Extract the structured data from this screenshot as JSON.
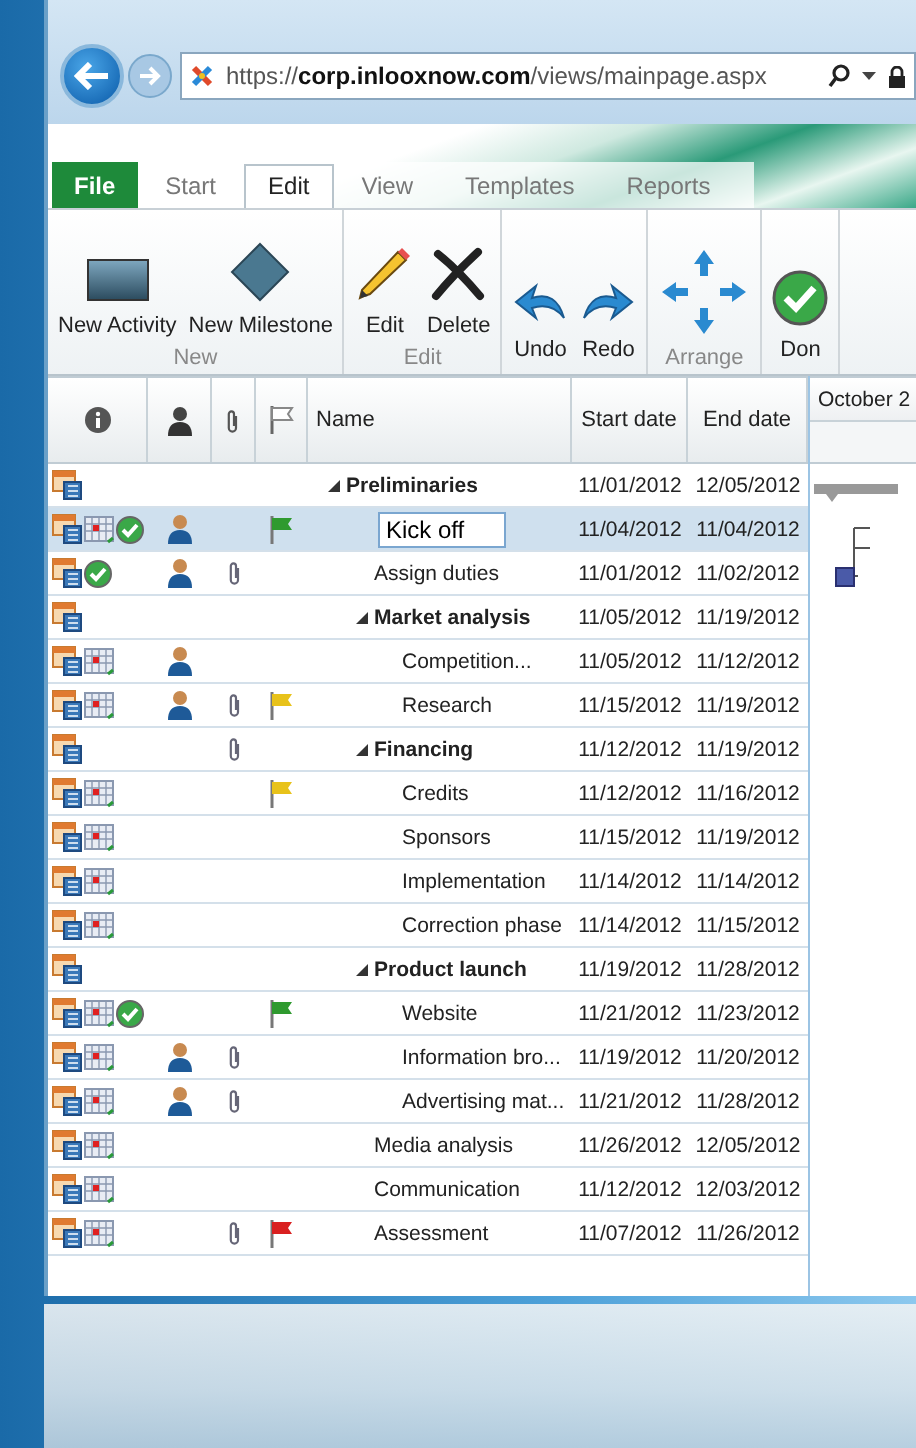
{
  "browser": {
    "url": "https://**corp.inlooxnow.com**/views/mainpage.aspx"
  },
  "tabs": [
    {
      "label": "File",
      "kind": "file",
      "selected": false
    },
    {
      "label": "Start",
      "kind": "tab",
      "selected": false
    },
    {
      "label": "Edit",
      "kind": "tab",
      "selected": true
    },
    {
      "label": "View",
      "kind": "tab",
      "selected": false
    },
    {
      "label": "Templates",
      "kind": "tab",
      "selected": false
    },
    {
      "label": "Reports",
      "kind": "tab",
      "selected": false
    }
  ],
  "ribbon_groups": [
    {
      "label": "New",
      "buttons": [
        {
          "label": "New Activity",
          "kind": "activity"
        },
        {
          "label": "New Milestone",
          "kind": "milestone"
        }
      ]
    },
    {
      "label": "Edit",
      "buttons": [
        {
          "label": "Edit",
          "kind": "pencil"
        },
        {
          "label": "Delete",
          "kind": "cross"
        }
      ]
    },
    {
      "buttons": [
        {
          "label": "Undo",
          "kind": "undo"
        },
        {
          "label": "Redo",
          "kind": "redo"
        }
      ]
    },
    {
      "label": "Arrange",
      "buttons": [
        {
          "kind": "arrows"
        }
      ]
    },
    {
      "buttons": [
        {
          "label": "Don",
          "kind": "done"
        }
      ]
    }
  ],
  "grid": {
    "columns": [
      "Name",
      "Start date",
      "End date"
    ],
    "gantt_header": "October 2",
    "rows": [
      {
        "name": "Preliminaries",
        "start": "11/01/2012",
        "end": "12/05/2012",
        "selected": false,
        "expanded": true,
        "scheduled": false,
        "done": false,
        "assigned": false,
        "attachment": false,
        "children": [
          {
            "name": "Kick off",
            "start": "11/04/2012",
            "end": "11/04/2012",
            "selected": true,
            "scheduled": true,
            "done": true,
            "assigned": true,
            "attachment": false,
            "color": "#2f9a2f"
          },
          {
            "name": "Assign duties",
            "start": "11/01/2012",
            "end": "11/02/2012",
            "selected": false,
            "scheduled": false,
            "done": true,
            "assigned": true,
            "attachment": true
          },
          {
            "name": "Market analysis",
            "start": "11/05/2012",
            "end": "11/19/2012",
            "selected": false,
            "expanded": true,
            "scheduled": false,
            "done": false,
            "assigned": false,
            "attachment": false,
            "children": [
              {
                "name": "Competition...",
                "start": "11/05/2012",
                "end": "11/12/2012",
                "selected": false,
                "scheduled": true,
                "done": false,
                "assigned": true,
                "attachment": false
              },
              {
                "name": "Research",
                "start": "11/15/2012",
                "end": "11/19/2012",
                "selected": false,
                "scheduled": true,
                "done": false,
                "assigned": true,
                "attachment": true,
                "color": "#e8c21a"
              }
            ]
          },
          {
            "name": "Financing",
            "start": "11/12/2012",
            "end": "11/19/2012",
            "selected": false,
            "expanded": true,
            "scheduled": false,
            "done": false,
            "assigned": false,
            "attachment": true,
            "children": [
              {
                "name": "Credits",
                "start": "11/12/2012",
                "end": "11/16/2012",
                "selected": false,
                "scheduled": true,
                "done": false,
                "assigned": false,
                "attachment": false,
                "color": "#e8c21a"
              },
              {
                "name": "Sponsors",
                "start": "11/15/2012",
                "end": "11/19/2012",
                "selected": false,
                "scheduled": true,
                "done": false,
                "assigned": false,
                "attachment": false
              },
              {
                "name": "Implementation",
                "start": "11/14/2012",
                "end": "11/14/2012",
                "selected": false,
                "scheduled": true,
                "done": false,
                "assigned": false,
                "attachment": false
              },
              {
                "name": "Correction phase",
                "start": "11/14/2012",
                "end": "11/15/2012",
                "selected": false,
                "scheduled": true,
                "done": false,
                "assigned": false,
                "attachment": false
              }
            ]
          },
          {
            "name": "Product launch",
            "start": "11/19/2012",
            "end": "11/28/2012",
            "selected": false,
            "expanded": true,
            "scheduled": false,
            "done": false,
            "assigned": false,
            "attachment": false,
            "children": [
              {
                "name": "Website",
                "start": "11/21/2012",
                "end": "11/23/2012",
                "selected": false,
                "scheduled": true,
                "done": true,
                "assigned": false,
                "attachment": false,
                "color": "#2f9a2f"
              },
              {
                "name": "Information bro...",
                "start": "11/19/2012",
                "end": "11/20/2012",
                "selected": false,
                "scheduled": true,
                "done": false,
                "assigned": true,
                "attachment": true
              },
              {
                "name": "Advertising mat...",
                "start": "11/21/2012",
                "end": "11/28/2012",
                "selected": false,
                "scheduled": true,
                "done": false,
                "assigned": true,
                "attachment": true
              }
            ]
          },
          {
            "name": "Media analysis",
            "start": "11/26/2012",
            "end": "12/05/2012",
            "selected": false,
            "scheduled": true,
            "done": false,
            "assigned": false,
            "attachment": false
          },
          {
            "name": "Communication",
            "start": "11/12/2012",
            "end": "12/03/2012",
            "selected": false,
            "scheduled": true,
            "done": false,
            "assigned": false,
            "attachment": false
          },
          {
            "name": "Assessment",
            "start": "11/07/2012",
            "end": "11/26/2012",
            "selected": false,
            "scheduled": true,
            "done": false,
            "assigned": false,
            "attachment": true,
            "color": "#d92020"
          }
        ]
      }
    ]
  }
}
